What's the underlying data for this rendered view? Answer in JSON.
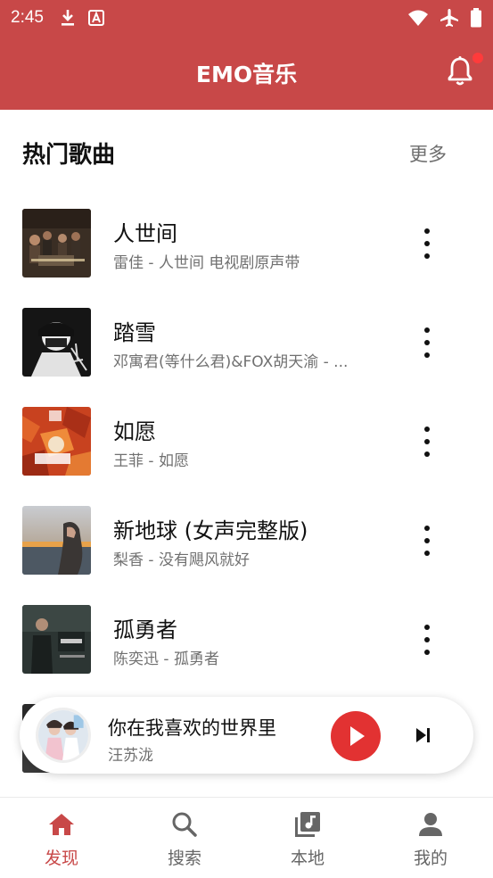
{
  "status_bar": {
    "time": "2:45"
  },
  "header": {
    "title": "EMO音乐"
  },
  "section": {
    "title": "热门歌曲",
    "more": "更多"
  },
  "songs": [
    {
      "title": "人世间",
      "subtitle": "雷佳 - 人世间 电视剧原声带"
    },
    {
      "title": "踏雪",
      "subtitle": "邓寓君(等什么君)&FOX胡天渝 - ..."
    },
    {
      "title": "如愿",
      "subtitle": "王菲 - 如愿"
    },
    {
      "title": "新地球 (女声完整版)",
      "subtitle": "梨香 - 没有飓风就好"
    },
    {
      "title": "孤勇者",
      "subtitle": "陈奕迅 - 孤勇者"
    }
  ],
  "now_playing": {
    "title": "你在我喜欢的世界里",
    "artist": "汪苏泷"
  },
  "bottom_nav": [
    {
      "label": "发现",
      "icon": "home-icon",
      "active": true
    },
    {
      "label": "搜索",
      "icon": "search-icon",
      "active": false
    },
    {
      "label": "本地",
      "icon": "library-music-icon",
      "active": false
    },
    {
      "label": "我的",
      "icon": "person-icon",
      "active": false
    }
  ],
  "colors": {
    "brand": "#c84848",
    "play": "#e23232",
    "badge": "#ff3b3b"
  }
}
